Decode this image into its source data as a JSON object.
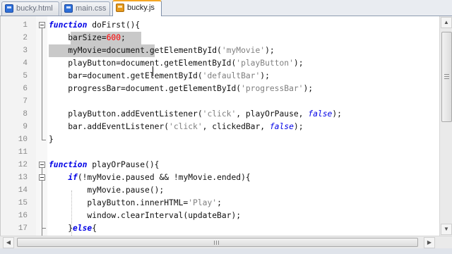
{
  "tabs": [
    {
      "label": "bucky.html",
      "icon": "file-icon",
      "active": false
    },
    {
      "label": "main.css",
      "icon": "file-icon",
      "active": false
    },
    {
      "label": "bucky.js",
      "icon": "file-icon",
      "active": true
    }
  ],
  "editor": {
    "language": "javascript",
    "lines": [
      {
        "n": "1",
        "tokens": [
          {
            "t": "function",
            "c": "kw"
          },
          {
            "t": " doFirst(){"
          }
        ]
      },
      {
        "n": "2",
        "tokens": [
          {
            "t": "    barSize="
          },
          {
            "t": "600",
            "c": "num"
          },
          {
            "t": ";"
          }
        ]
      },
      {
        "n": "3",
        "tokens": [
          {
            "t": "    myMovie=document.getElementById("
          },
          {
            "t": "'myMovie'",
            "c": "str"
          },
          {
            "t": ");"
          }
        ]
      },
      {
        "n": "4",
        "tokens": [
          {
            "t": "    playButton=document.getElementById("
          },
          {
            "t": "'playButton'",
            "c": "str"
          },
          {
            "t": ");"
          }
        ]
      },
      {
        "n": "5",
        "tokens": [
          {
            "t": "    bar=document.getElementById("
          },
          {
            "t": "'defaultBar'",
            "c": "str"
          },
          {
            "t": ");"
          }
        ]
      },
      {
        "n": "6",
        "tokens": [
          {
            "t": "    progressBar=document.getElementById("
          },
          {
            "t": "'progressBar'",
            "c": "str"
          },
          {
            "t": ");"
          }
        ]
      },
      {
        "n": "7",
        "tokens": []
      },
      {
        "n": "8",
        "tokens": [
          {
            "t": "    playButton.addEventListener("
          },
          {
            "t": "'click'",
            "c": "str"
          },
          {
            "t": ", playOrPause, "
          },
          {
            "t": "false",
            "c": "kw2"
          },
          {
            "t": ");"
          }
        ]
      },
      {
        "n": "9",
        "tokens": [
          {
            "t": "    bar.addEventListener("
          },
          {
            "t": "'click'",
            "c": "str"
          },
          {
            "t": ", clickedBar, "
          },
          {
            "t": "false",
            "c": "kw2"
          },
          {
            "t": ");"
          }
        ]
      },
      {
        "n": "10",
        "tokens": [
          {
            "t": "}"
          }
        ]
      },
      {
        "n": "11",
        "tokens": []
      },
      {
        "n": "12",
        "tokens": [
          {
            "t": "function",
            "c": "kw"
          },
          {
            "t": " playOrPause(){"
          }
        ]
      },
      {
        "n": "13",
        "tokens": [
          {
            "t": "    "
          },
          {
            "t": "if",
            "c": "kw"
          },
          {
            "t": "(!myMovie.paused && !myMovie.ended){"
          }
        ]
      },
      {
        "n": "14",
        "tokens": [
          {
            "t": "        myMovie.pause();"
          }
        ]
      },
      {
        "n": "15",
        "tokens": [
          {
            "t": "        playButton.innerHTML="
          },
          {
            "t": "'Play'",
            "c": "str"
          },
          {
            "t": ";"
          }
        ]
      },
      {
        "n": "16",
        "tokens": [
          {
            "t": "        window.clearInterval(updateBar);"
          }
        ]
      },
      {
        "n": "17",
        "tokens": [
          {
            "t": "    }"
          },
          {
            "t": "else",
            "c": "kw"
          },
          {
            "t": "{"
          }
        ]
      }
    ]
  },
  "scrollbars": {
    "up_arrow": "▲",
    "down_arrow": "▼",
    "left_arrow": "◀",
    "right_arrow": "▶"
  }
}
